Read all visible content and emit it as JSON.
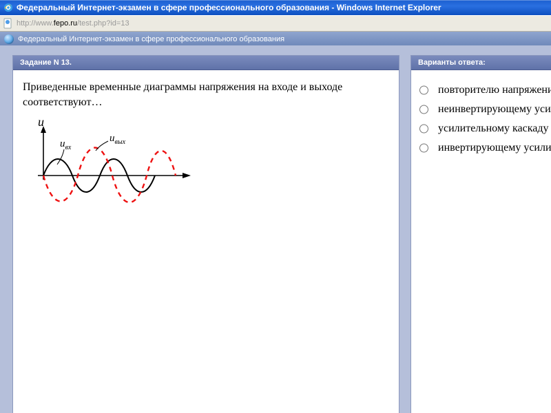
{
  "window": {
    "title": "Федеральный Интернет-экзамен в сфере профессионального образования - Windows Internet Explorer"
  },
  "address": {
    "prefix": "http://www.",
    "domain": "fepo.ru",
    "path": "/test.php?id=13"
  },
  "appbar": {
    "title": "Федеральный Интернет-экзамен в сфере профессионального образования"
  },
  "question": {
    "header": "Задание N 13.",
    "text": "Приведенные временные диаграммы напряжения на входе и выходе соответствуют…",
    "axis_label": "u",
    "signal_in_label": "u",
    "signal_in_sub": "вх",
    "signal_out_label": "u",
    "signal_out_sub": "вых"
  },
  "answers": {
    "header": "Варианты ответа:",
    "items": [
      "повторителю напряжения на о",
      "неинвертирующему усилител",
      "усилительному каскаду с общ",
      "инвертирующему усилителю"
    ]
  }
}
